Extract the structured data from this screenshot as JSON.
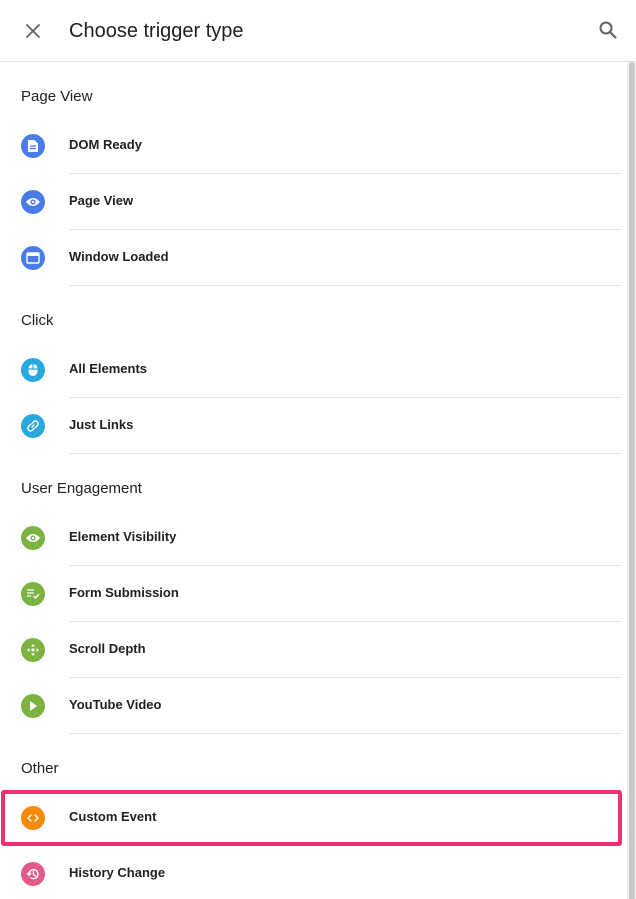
{
  "header": {
    "title": "Choose trigger type",
    "close_icon": "close-icon",
    "search_icon": "search-icon"
  },
  "sections": [
    {
      "heading": "Page View",
      "items": [
        {
          "label": "DOM Ready",
          "icon": "document-icon",
          "color": "#4a7ce8"
        },
        {
          "label": "Page View",
          "icon": "eye-icon",
          "color": "#4a7ce8"
        },
        {
          "label": "Window Loaded",
          "icon": "window-icon",
          "color": "#4a7ce8"
        }
      ]
    },
    {
      "heading": "Click",
      "items": [
        {
          "label": "All Elements",
          "icon": "mouse-icon",
          "color": "#29a8e0"
        },
        {
          "label": "Just Links",
          "icon": "link-icon",
          "color": "#29a8e0"
        }
      ]
    },
    {
      "heading": "User Engagement",
      "items": [
        {
          "label": "Element Visibility",
          "icon": "eye-icon",
          "color": "#7cb342"
        },
        {
          "label": "Form Submission",
          "icon": "form-check-icon",
          "color": "#7cb342"
        },
        {
          "label": "Scroll Depth",
          "icon": "move-arrows-icon",
          "color": "#7cb342"
        },
        {
          "label": "YouTube Video",
          "icon": "play-icon",
          "color": "#7cb342"
        }
      ]
    },
    {
      "heading": "Other",
      "items": [
        {
          "label": "Custom Event",
          "icon": "code-icon",
          "color": "#f58a07",
          "highlighted": true
        },
        {
          "label": "History Change",
          "icon": "history-icon",
          "color": "#e25a8a"
        }
      ]
    }
  ],
  "highlight_color": "#f1306f"
}
